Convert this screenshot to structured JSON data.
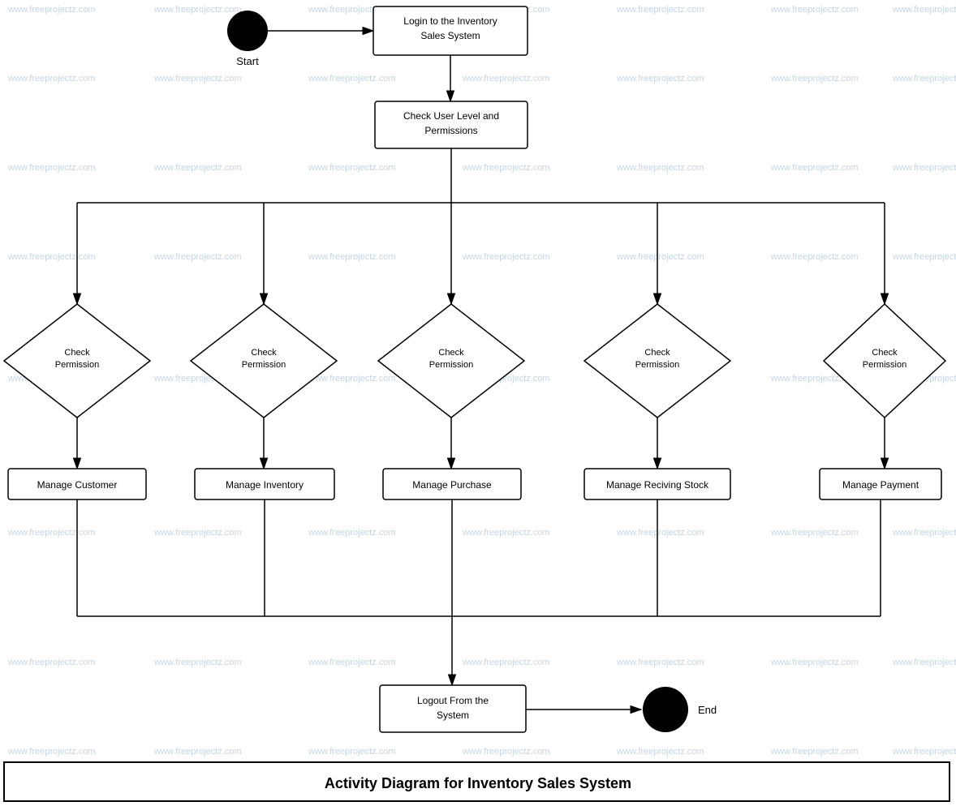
{
  "diagram": {
    "title": "Activity Diagram for Inventory Sales System",
    "watermark": "www.freeprojectz.com",
    "nodes": {
      "start_label": "Start",
      "end_label": "End",
      "login": "Login to the Inventory Sales System",
      "check_user_level": "Check User Level and Permissions",
      "check_perm1": "Check Permission",
      "check_perm2": "Check Permission",
      "check_perm3": "Check Permission",
      "check_perm4": "Check Permission",
      "check_perm5": "Check Permission",
      "manage_customer": "Manage Customer",
      "manage_inventory": "Manage Inventory",
      "manage_purchase": "Manage Purchase",
      "manage_receiving": "Manage Reciving Stock",
      "manage_payment": "Manage Payment",
      "logout": "Logout From the System"
    }
  }
}
